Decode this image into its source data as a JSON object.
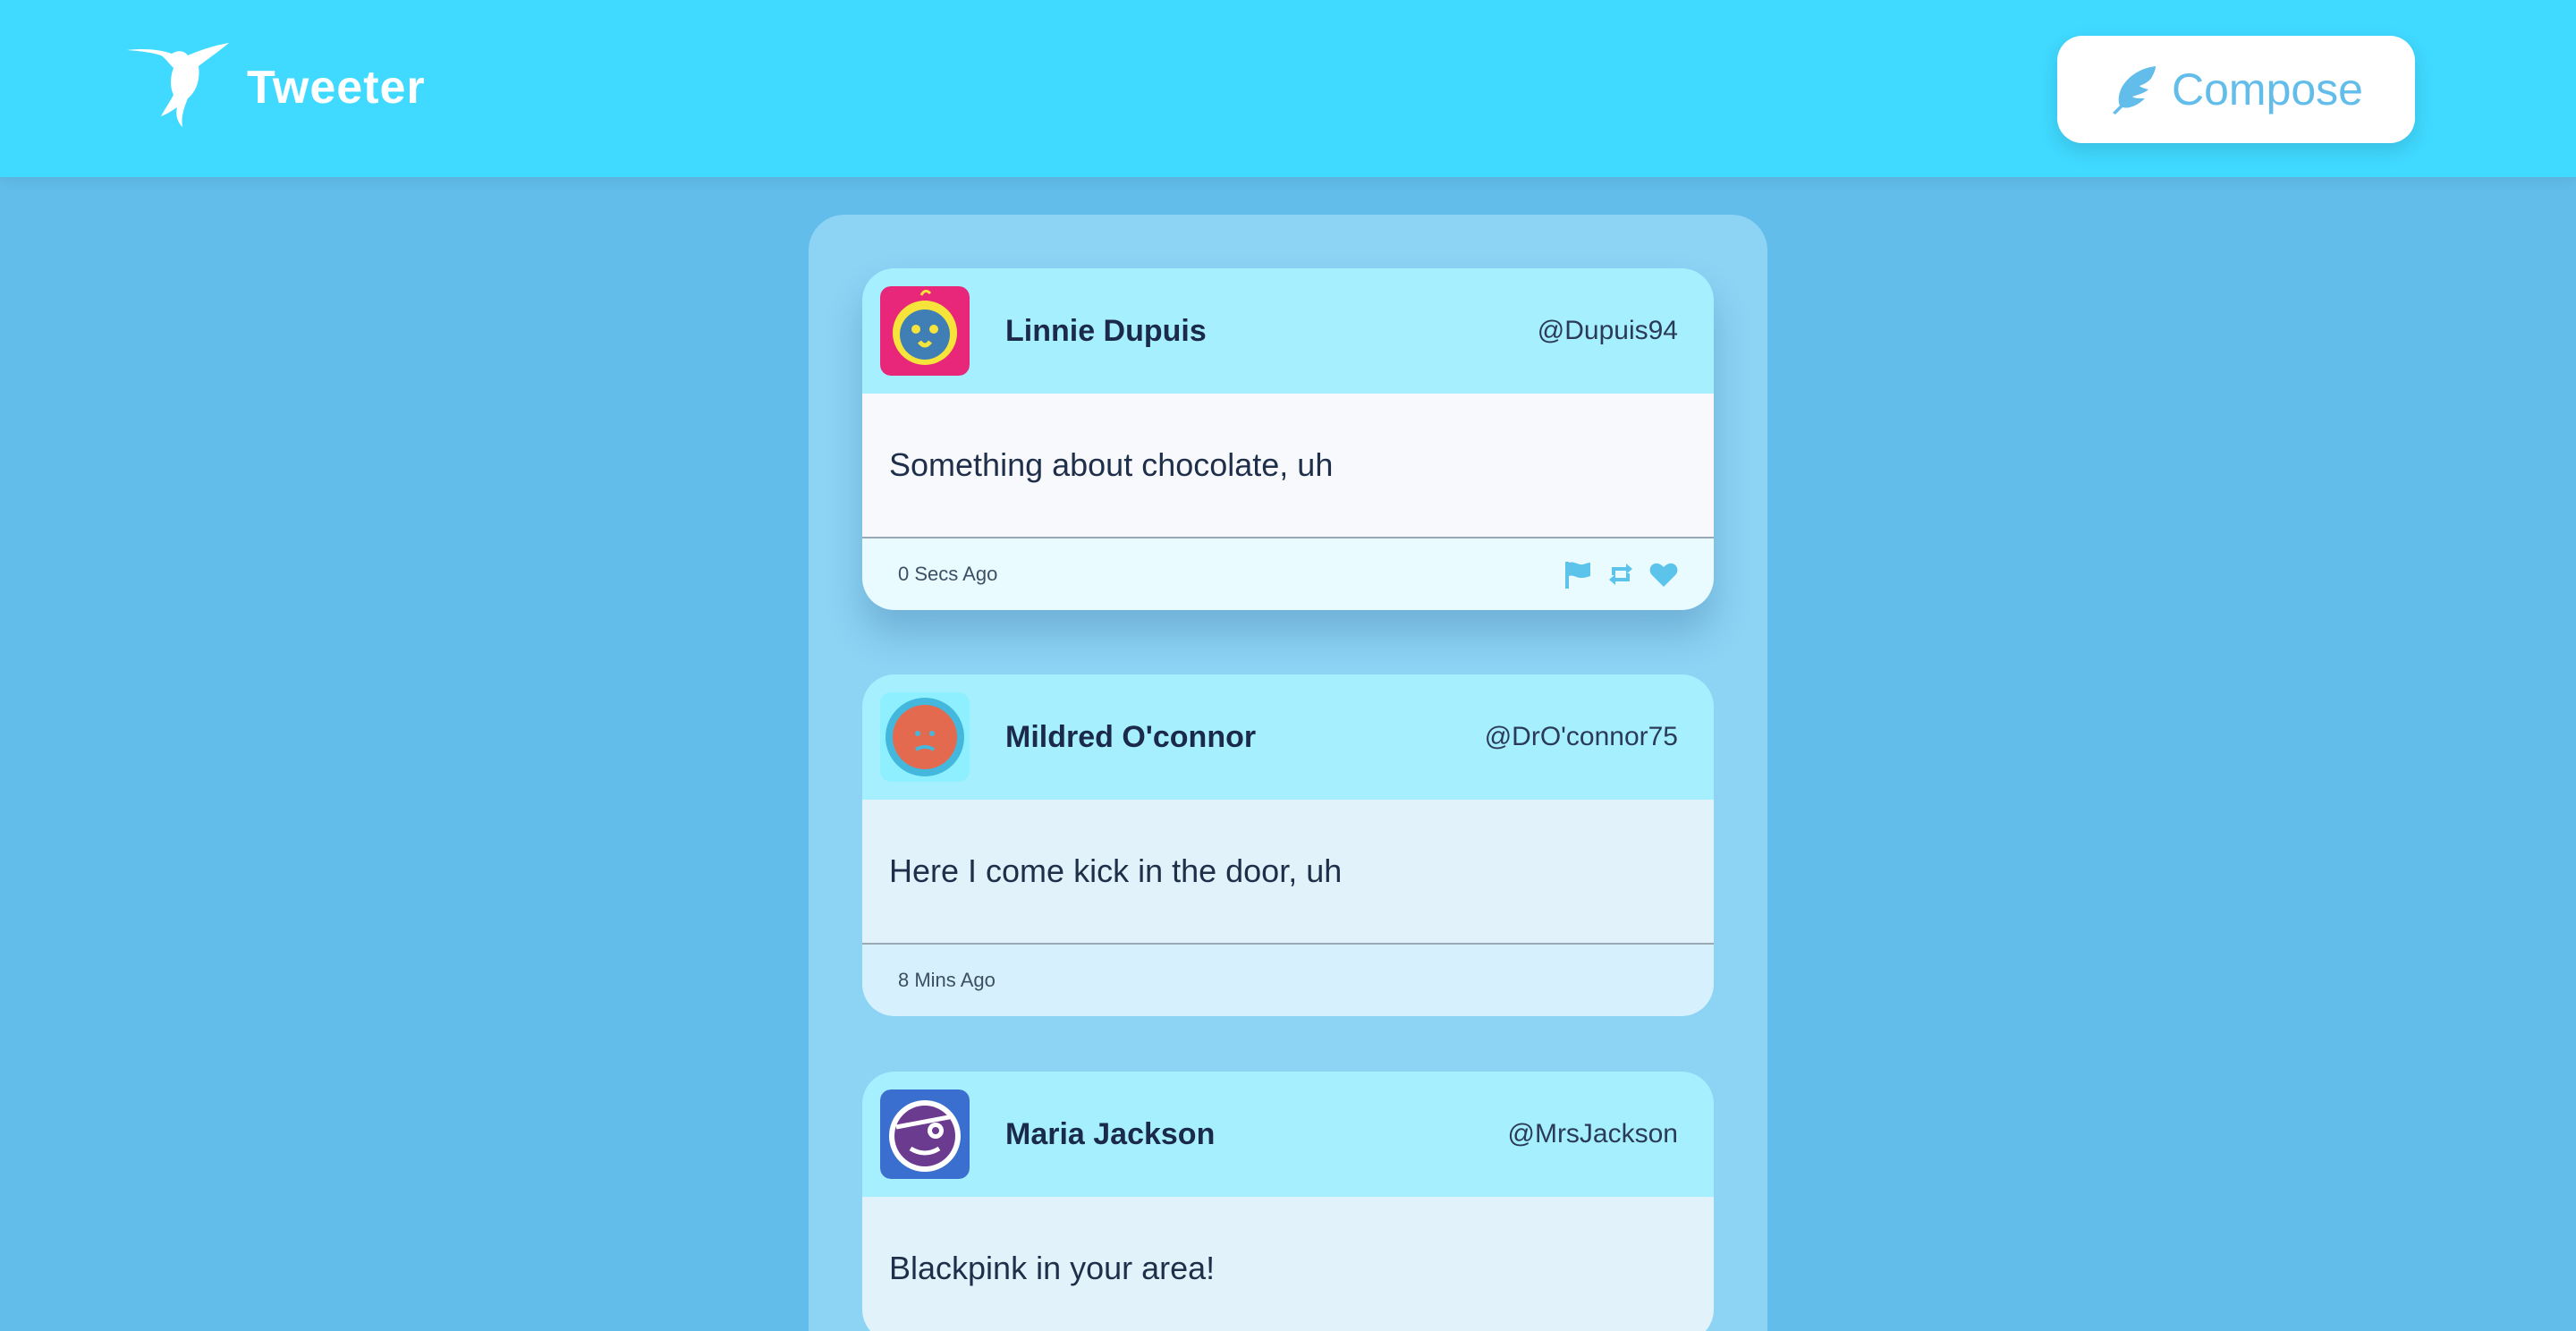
{
  "app": {
    "name": "Tweeter"
  },
  "header": {
    "logo_icon": "hummingbird-icon",
    "compose_label": "Compose",
    "compose_icon": "feather-icon"
  },
  "colors": {
    "header_bg": "#40d9ff",
    "page_bg": "#62bdea",
    "feed_bg": "#8cd3f4",
    "accent": "#62bdea",
    "name_text": "#1b2a4a"
  },
  "tweets": [
    {
      "name": "Linnie Dupuis",
      "handle": "@Dupuis94",
      "text": "Something about chocolate, uh",
      "time": "0 Secs Ago",
      "avatar_icon": "cookie-face-avatar-icon",
      "actions": [
        "flag-icon",
        "retweet-icon",
        "heart-icon"
      ]
    },
    {
      "name": "Mildred O'connor",
      "handle": "@DrO'connor75",
      "text": "Here I come kick in the door, uh",
      "time": "8 Mins Ago",
      "avatar_icon": "orange-face-avatar-icon"
    },
    {
      "name": "Maria Jackson",
      "handle": "@MrsJackson",
      "text": "Blackpink in your area!",
      "avatar_icon": "pirate-face-avatar-icon"
    }
  ]
}
